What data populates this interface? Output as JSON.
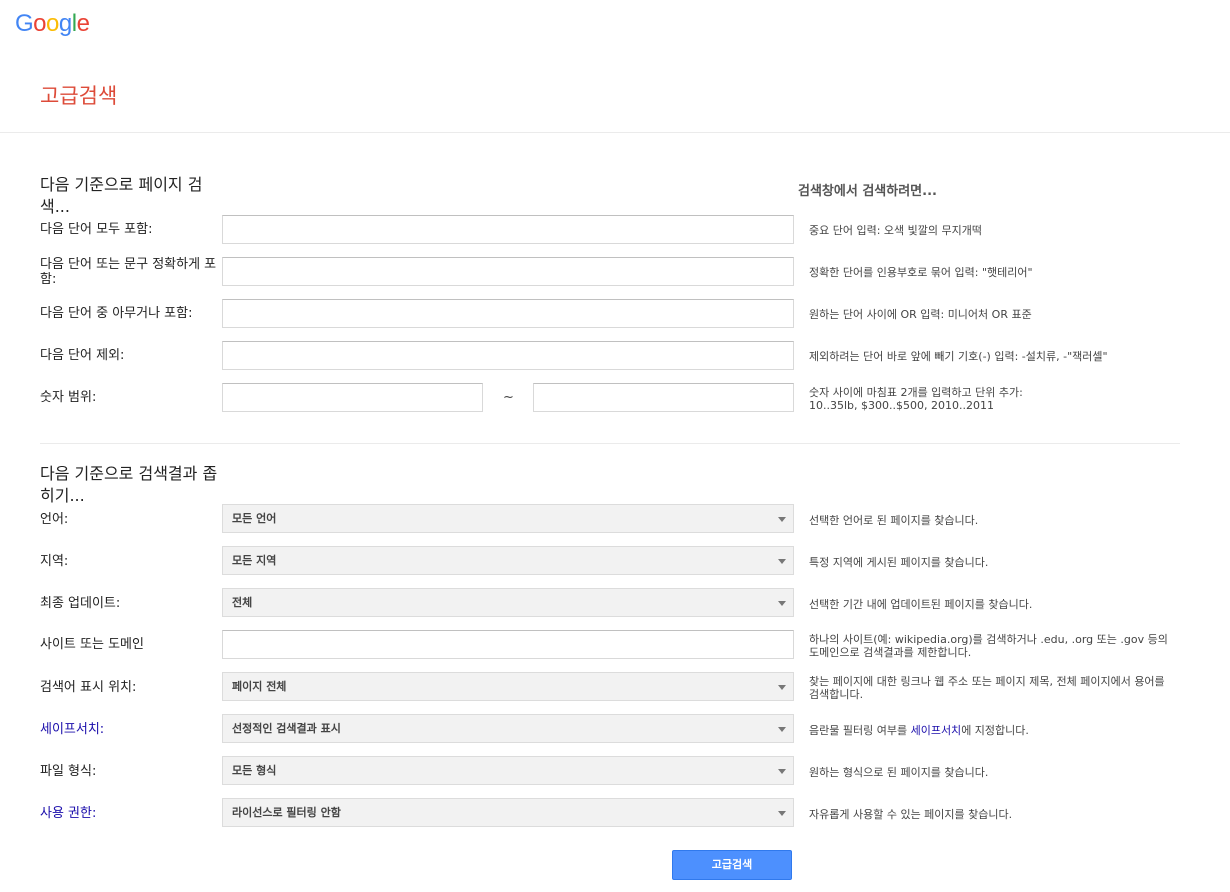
{
  "logo": {
    "text": "Google",
    "letters": [
      "G",
      "o",
      "o",
      "g",
      "l",
      "e"
    ],
    "colors": [
      "#4285F4",
      "#EA4335",
      "#FBBC05",
      "#4285F4",
      "#34A853",
      "#EA4335"
    ]
  },
  "page_title": "고급검색",
  "section1": {
    "title": "다음 기준으로 페이지 검색...",
    "side_header": "검색창에서 검색하려면...",
    "rows": [
      {
        "label": "다음 단어 모두 포함:",
        "value": "",
        "hint": "중요 단어 입력: 오색 빛깔의 무지개떡"
      },
      {
        "label": "다음 단어 또는 문구 정확하게 포함:",
        "value": "",
        "hint": "정확한 단어를 인용부호로 묶어 입력: \"햇테리어\""
      },
      {
        "label": "다음 단어 중 아무거나 포함:",
        "value": "",
        "hint": "원하는 단어 사이에 OR 입력: 미니어처 OR 표준"
      },
      {
        "label": "다음 단어 제외:",
        "value": "",
        "hint": "제외하려는 단어 바로 앞에 빼기 기호(-) 입력: -설치류, -\"잭러셀\""
      }
    ],
    "range": {
      "label": "숫자 범위:",
      "from_value": "",
      "to_value": "",
      "separator": "~",
      "hint_line1": "숫자 사이에 마침표 2개를 입력하고 단위 추가:",
      "hint_line2": "10..35lb, $300..$500, 2010..2011"
    }
  },
  "section2": {
    "title": "다음 기준으로 검색결과 좁히기...",
    "rows": [
      {
        "label": "언어:",
        "selected": "모든 언어",
        "hint": "선택한 언어로 된 페이지를 찾습니다."
      },
      {
        "label": "지역:",
        "selected": "모든 지역",
        "hint": "특정 지역에 게시된 페이지를 찾습니다."
      },
      {
        "label": "최종 업데이트:",
        "selected": "전체",
        "hint": "선택한 기간 내에 업데이트된 페이지를 찾습니다."
      },
      {
        "label": "사이트 또는 도메인",
        "value": "",
        "hint": "하나의 사이트(예: wikipedia.org)를 검색하거나 .edu, .org 또는 .gov 등의 도메인으로 검색결과를 제한합니다."
      },
      {
        "label": "검색어 표시 위치:",
        "selected": "페이지 전체",
        "hint": "찾는 페이지에 대한 링크나 웹 주소 또는 페이지 제목, 전체 페이지에서 용어를 검색합니다."
      },
      {
        "label": "세이프서치:",
        "selected": "선정적인 검색결과 표시",
        "hint_before": "음란물 필터링 여부를 ",
        "hint_link": "세이프서치",
        "hint_after": "에 지정합니다."
      },
      {
        "label": "파일 형식:",
        "selected": "모든 형식",
        "hint": "원하는 형식으로 된 페이지를 찾습니다."
      },
      {
        "label": "사용 권한:",
        "selected": "라이선스로 필터링 안함",
        "hint": "자유롭게 사용할 수 있는 페이지를 찾습니다."
      }
    ]
  },
  "submit_label": "고급검색"
}
